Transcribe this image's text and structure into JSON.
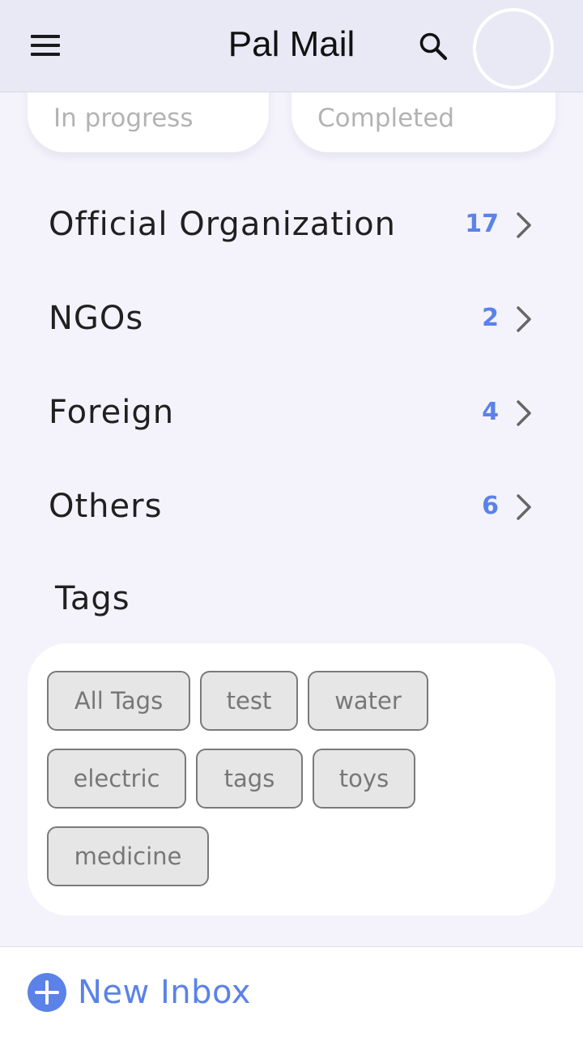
{
  "header": {
    "title": "Pal Mail",
    "menu_icon": "hamburger-menu-icon",
    "search_icon": "search-icon"
  },
  "filters": {
    "in_progress": "In progress",
    "completed": "Completed"
  },
  "categories": [
    {
      "label": "Official Organization",
      "count": "17"
    },
    {
      "label": "NGOs",
      "count": "2"
    },
    {
      "label": "Foreign",
      "count": "4"
    },
    {
      "label": "Others",
      "count": "6"
    }
  ],
  "tags": {
    "title": "Tags",
    "items": [
      "All Tags",
      "test",
      "water",
      "electric",
      "tags",
      "toys",
      "medicine"
    ]
  },
  "bottom": {
    "new_inbox_label": "New Inbox",
    "icon": "add-circle-icon"
  },
  "colors": {
    "accent": "#5b82e8",
    "header_bg": "#e9e8f5",
    "page_bg": "#f4f3fb",
    "chip_bg": "#e6e6e6"
  }
}
